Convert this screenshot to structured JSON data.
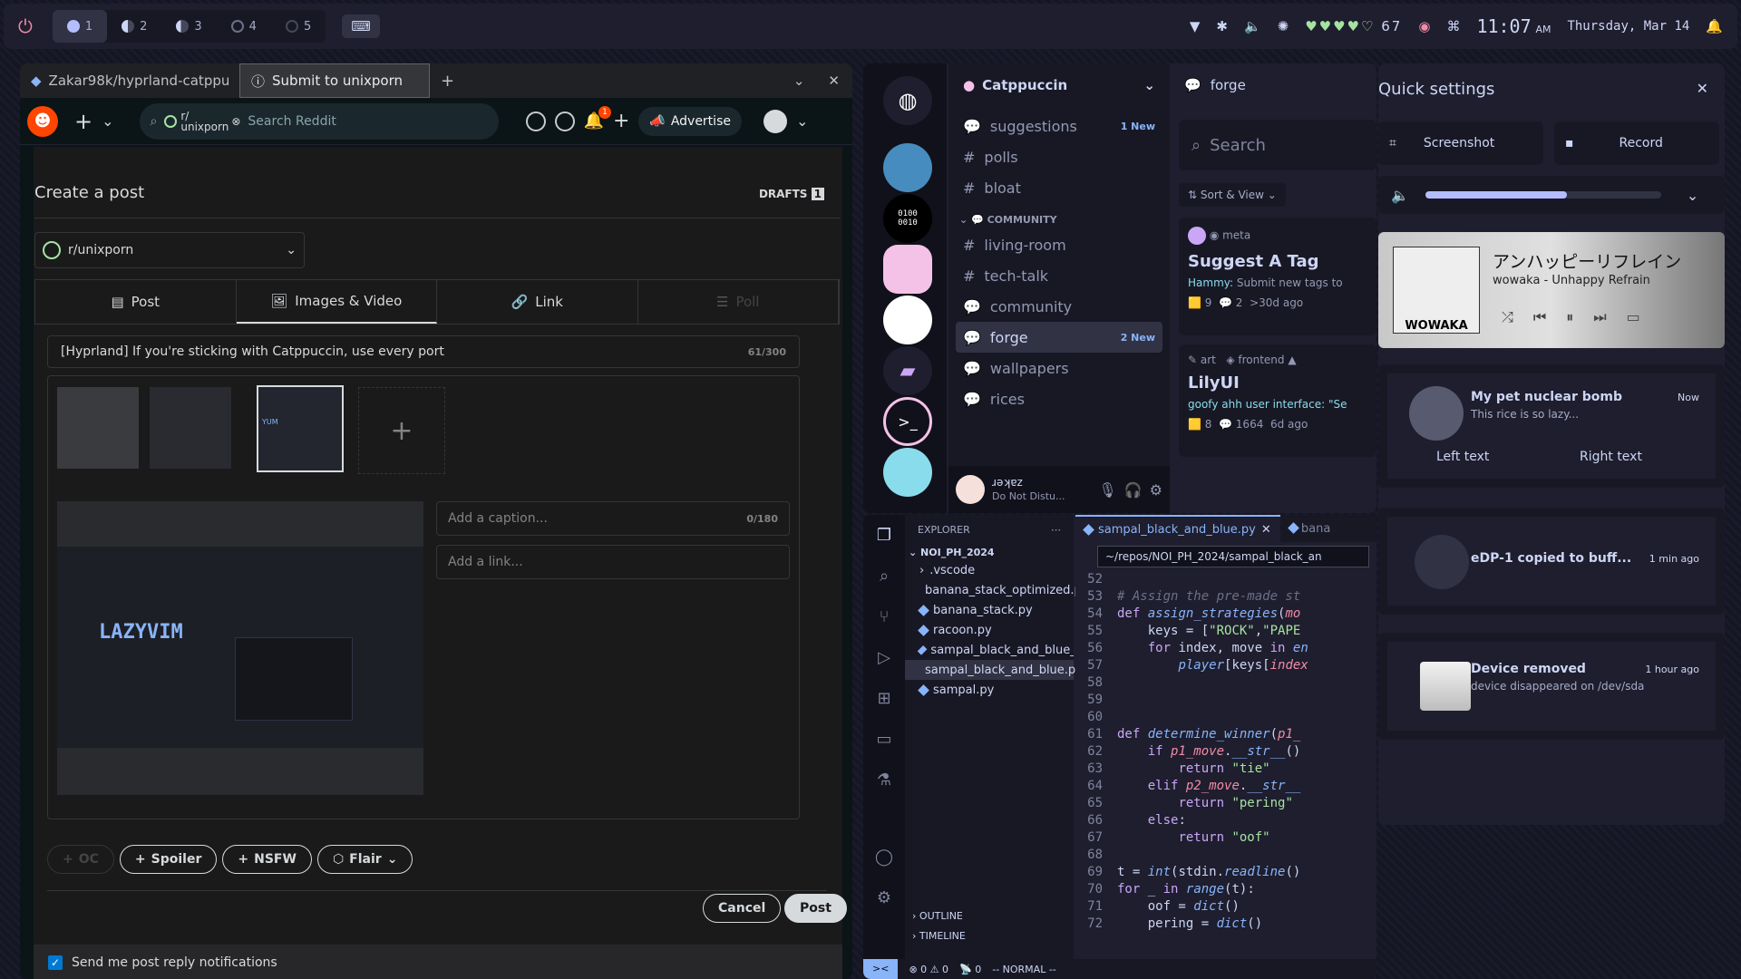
{
  "topbar": {
    "workspaces": [
      "1",
      "2",
      "3",
      "4",
      "5"
    ],
    "battery": "67",
    "time": "11:07",
    "ampm": "AM",
    "date": "Thursday, Mar 14"
  },
  "browser": {
    "tabs": [
      "Zakar98k/hyprland-catppu",
      "Submit to unixporn"
    ],
    "community_pill": "r/ unixporn",
    "search_placeholder": "Search Reddit",
    "notif_count": "1",
    "advertise": "Advertise",
    "create_title": "Create a post",
    "drafts": "DRAFTS",
    "drafts_count": "1",
    "community": "r/unixporn",
    "post_tabs": [
      "Post",
      "Images & Video",
      "Link",
      "Poll"
    ],
    "title_value": "[Hyprland] If you're sticking with Catppuccin, use every port",
    "title_count": "61/300",
    "caption_placeholder": "Add a caption...",
    "caption_count": "0/180",
    "link_placeholder": "Add a link...",
    "preview_text": "LAZYVIM",
    "thumb_text": "YUM",
    "buttons": [
      "OC",
      "Spoiler",
      "NSFW",
      "Flair"
    ],
    "cancel": "Cancel",
    "post": "Post",
    "notify": "Send me post reply notifications"
  },
  "discord": {
    "server": "Catppuccin",
    "channels": [
      {
        "name": "suggestions",
        "badge": "1 New",
        "type": "forum"
      },
      {
        "name": "polls",
        "badge": "",
        "type": "text"
      },
      {
        "name": "bloat",
        "badge": "",
        "type": "text"
      }
    ],
    "category": "COMMUNITY",
    "channels2": [
      {
        "name": "living-room",
        "type": "text"
      },
      {
        "name": "tech-talk",
        "type": "text"
      },
      {
        "name": "community",
        "type": "forum"
      },
      {
        "name": "forge",
        "type": "forum",
        "badge": "2 New"
      },
      {
        "name": "wallpapers",
        "type": "forum"
      },
      {
        "name": "rices",
        "type": "forum"
      }
    ],
    "user": "ɹəʞɐz",
    "status": "Do Not Distu...",
    "forum_title": "forge",
    "forum_search": "Search",
    "sort": "Sort & View",
    "post1": {
      "tag": "meta",
      "title": "Suggest A Tag",
      "author": "Hammy:",
      "text": "Submit new tags to",
      "votes": "9",
      "replies": "2",
      "time": ">30d ago"
    },
    "post2": {
      "tags": [
        "art",
        "frontend"
      ],
      "title": "LilyUI",
      "text": "goofy ahh user interface: \"Se",
      "votes": "8",
      "replies": "1664",
      "time": "6d ago"
    }
  },
  "quick": {
    "title": "Quick settings",
    "screenshot": "Screenshot",
    "record": "Record",
    "volume": 0.6,
    "track": "アンハッピーリフレイン",
    "artist": "wowaka - Unhappy Refrain",
    "art_text": "WOWAKA",
    "notifs": [
      {
        "title": "My pet nuclear bomb",
        "body": "This rice is so lazy...",
        "time": "Now",
        "left": "Left text",
        "right": "Right text"
      },
      {
        "title": "eDP-1 copied to buff...",
        "time": "1 min ago"
      },
      {
        "title": "Device removed",
        "body": "device disappeared on /dev/sda",
        "time": "1 hour ago"
      }
    ]
  },
  "vscode": {
    "explorer": "EXPLORER",
    "folder": "NOI_PH_2024",
    "files": [
      ".vscode",
      "banana_stack_optimized.py",
      "banana_stack.py",
      "racoon.py",
      "sampal_black_and_blue_optimiz...",
      "sampal_black_and_blue.py",
      "sampal.py"
    ],
    "tab": "sampal_black_and_blue.py",
    "tab2": "bana",
    "path": "~/repos/NOI_PH_2024/sampal_black_an",
    "outline": "OUTLINE",
    "timeline": "TIMELINE",
    "status": {
      "errors": "0",
      "warnings": "0",
      "ports": "0",
      "mode": "-- NORMAL --"
    },
    "first_line": 52
  }
}
